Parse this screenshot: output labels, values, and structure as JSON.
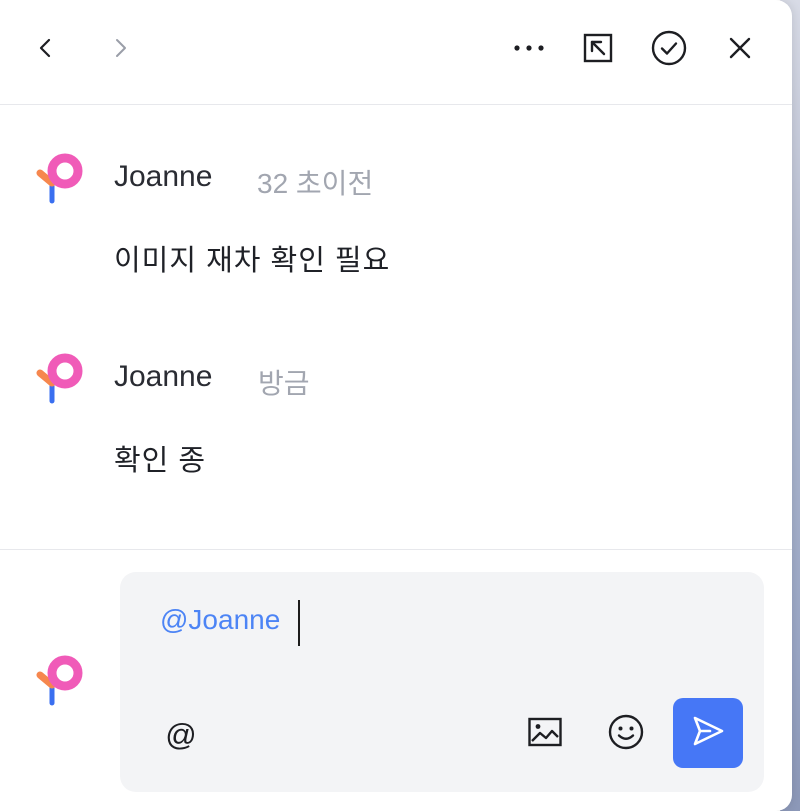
{
  "header": {
    "back_icon": "chevron-left-icon",
    "forward_icon": "chevron-right-icon",
    "more_icon": "more-horizontal-icon",
    "open_icon": "open-in-window-icon",
    "resolve_icon": "check-circle-icon",
    "close_icon": "close-icon"
  },
  "comments": [
    {
      "author": "Joanne",
      "time": "32 초이전",
      "text": "이미지 재차 확인 필요"
    },
    {
      "author": "Joanne",
      "time": "방금",
      "text": "확인 종"
    }
  ],
  "composer": {
    "value": "@Joanne",
    "mention_label": "@",
    "image_icon": "image-icon",
    "emoji_icon": "smiley-icon",
    "send_icon": "send-icon"
  },
  "colors": {
    "accent": "#4677f6",
    "mention": "#4c84f5",
    "avatar_pink": "#f05bb8",
    "avatar_orange": "#f6874e",
    "avatar_blue": "#3a6ff0"
  }
}
